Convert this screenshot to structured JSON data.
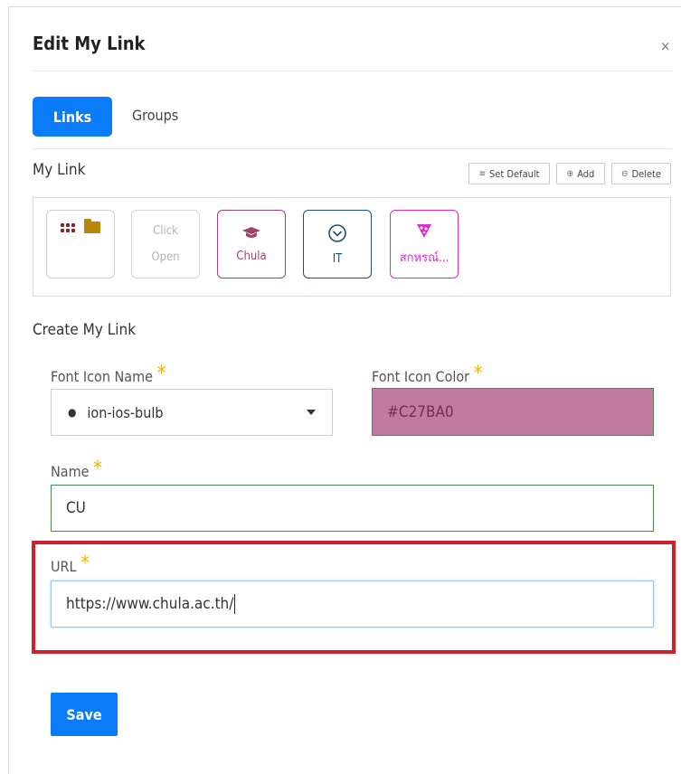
{
  "dialog": {
    "title": "Edit My Link",
    "close_glyph": "×"
  },
  "tabs": [
    {
      "label": "Links",
      "active": true
    },
    {
      "label": "Groups",
      "active": false
    }
  ],
  "my_link": {
    "title": "My Link",
    "toolbar": {
      "set_default": "Set Default",
      "add": "Add",
      "delete": "Delete"
    },
    "tiles": [
      {
        "type": "group",
        "icons": [
          "grid-icon",
          "folder-icon"
        ]
      },
      {
        "type": "placeholder",
        "line1": "Click",
        "line2": "Open"
      },
      {
        "type": "link",
        "icon": "graduation-cap-icon",
        "label": "Chula",
        "color": "#a0446e"
      },
      {
        "type": "link",
        "icon": "chevron-circle-icon",
        "label": "IT",
        "color": "#1f4f73"
      },
      {
        "type": "link",
        "icon": "pizza-icon",
        "label": "สกหรณ์...",
        "color": "#e02ad0"
      }
    ]
  },
  "create": {
    "title": "Create My Link",
    "font_icon_name": {
      "label": "Font Icon Name",
      "value": "ion-ios-bulb",
      "icon": "bulb-icon"
    },
    "font_icon_color": {
      "label": "Font Icon Color",
      "value": "#C27BA0",
      "swatch": "#C27BA0"
    },
    "name": {
      "label": "Name",
      "value": "CU"
    },
    "url": {
      "label": "URL",
      "value": "https://www.chula.ac.th/"
    },
    "required_mark": "*"
  },
  "save_label": "Save"
}
